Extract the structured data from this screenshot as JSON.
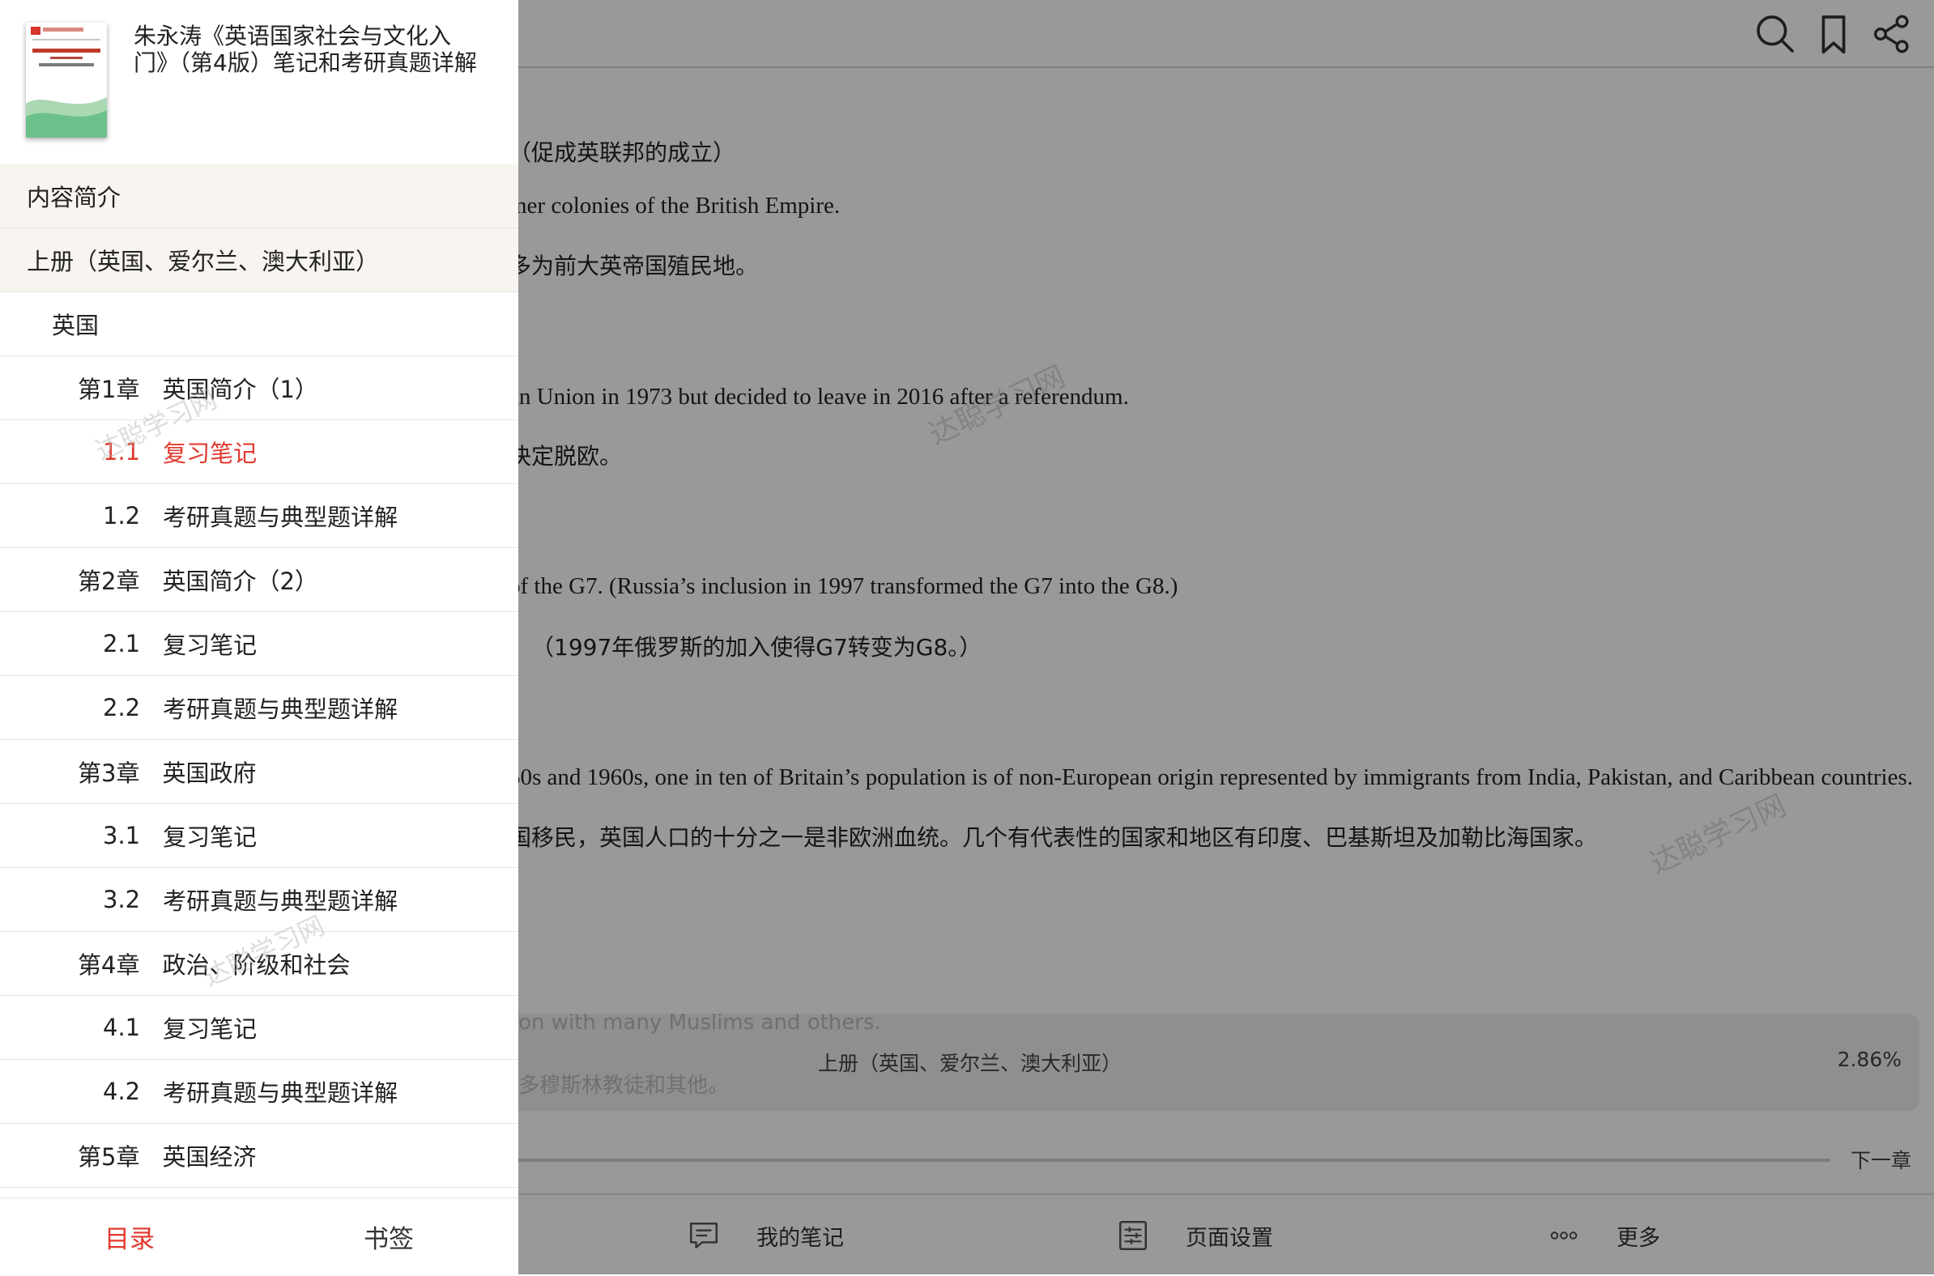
{
  "book": {
    "title": "朱永涛《英语国家社会与文化入门》（第4版）笔记和考研真题详解"
  },
  "toc": {
    "items": [
      {
        "label": "内容简介",
        "level": 0,
        "shaded": true
      },
      {
        "label": "上册（英国、爱尔兰、澳大利亚）",
        "level": 0,
        "shaded": true
      },
      {
        "label": "英国",
        "level": 1
      },
      {
        "num": "第1章",
        "label": "英国简介（1）",
        "level": 2
      },
      {
        "num": "1.1",
        "label": "复习笔记",
        "level": 3,
        "active": true
      },
      {
        "num": "1.2",
        "label": "考研真题与典型题详解",
        "level": 3
      },
      {
        "num": "第2章",
        "label": "英国简介（2）",
        "level": 2
      },
      {
        "num": "2.1",
        "label": "复习笔记",
        "level": 3
      },
      {
        "num": "2.2",
        "label": "考研真题与典型题详解",
        "level": 3
      },
      {
        "num": "第3章",
        "label": "英国政府",
        "level": 2
      },
      {
        "num": "3.1",
        "label": "复习笔记",
        "level": 3
      },
      {
        "num": "3.2",
        "label": "考研真题与典型题详解",
        "level": 3
      },
      {
        "num": "第4章",
        "label": "政治、阶级和社会",
        "level": 2
      },
      {
        "num": "4.1",
        "label": "复习笔记",
        "level": 3
      },
      {
        "num": "4.2",
        "label": "考研真题与典型题详解",
        "level": 3
      },
      {
        "num": "第5章",
        "label": "英国经济",
        "level": 2
      }
    ]
  },
  "drawer_tabs": {
    "contents": "目录",
    "bookmarks": "书签"
  },
  "reader": {
    "lines": [
      "（促成英联邦的成立）",
      "mer colonies of the British Empire.",
      "多为前大英帝国殖民地。",
      "an Union in 1973 but decided to leave in 2016 after a referendum.",
      "决定脱欧。",
      "of the G7. (Russia’s inclusion in 1997 transformed the G7 into the G8.)",
      "（1997年俄罗斯的加入使得G7转变为G8。）",
      "50s and 1960s, one in ten of Britain’s population is of non-European origin represented by immigrants from India, Pakistan, and Caribbean countries.",
      "国移民，英国人口的十分之一是非欧洲血统。几个有代表性的国家和地区有印度、巴基斯坦及加勒比海国家。"
    ],
    "hidden_lines": [
      "on with many Muslims and others.",
      "多穆斯林教徒和其他。"
    ],
    "watermark": "达聪学习网",
    "section": "上册（英国、爱尔兰、澳大利亚）",
    "progress": "2.86%",
    "next_chapter": "下一章"
  },
  "toolbar": {
    "notes": "我的笔记",
    "page_settings": "页面设置",
    "more": "更多"
  },
  "icons": {
    "search": "search-icon",
    "bookmark": "bookmark-icon",
    "share": "share-icon",
    "notes": "note-icon",
    "settings": "sliders-icon",
    "more": "ellipsis-icon"
  },
  "colors": {
    "accent": "#e23a2e",
    "shaded_row": "#f8f4ef"
  }
}
